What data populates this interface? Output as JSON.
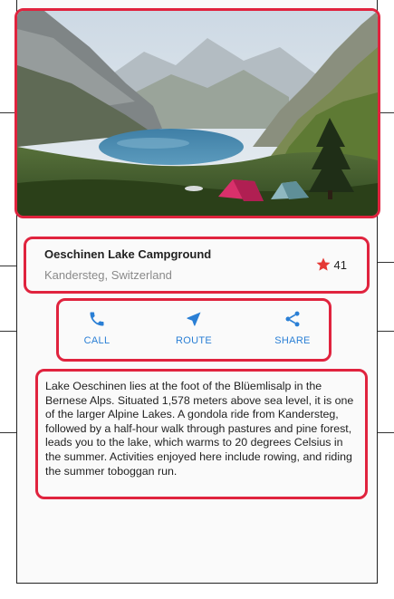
{
  "place": {
    "title": "Oeschinen Lake Campground",
    "location": "Kandersteg, Switzerland",
    "rating_count": "41"
  },
  "actions": [
    {
      "label": "CALL",
      "icon": "phone-icon"
    },
    {
      "label": "ROUTE",
      "icon": "navigation-arrow-icon"
    },
    {
      "label": "SHARE",
      "icon": "share-icon"
    }
  ],
  "description": "Lake Oeschinen lies at the foot of the Blüemlisalp in the Bernese Alps. Situated 1,578 meters above sea level, it is one of the larger Alpine Lakes. A gondola ride from Kandersteg, followed by a half-hour walk through pastures and pine forest, leads you to the lake, which warms to 20 degrees Celsius in the summer. Activities enjoyed here include rowing, and riding the summer toboggan run.",
  "colors": {
    "accent": "#2a7fd5",
    "star": "#e53935",
    "highlight": "#e0233e"
  }
}
